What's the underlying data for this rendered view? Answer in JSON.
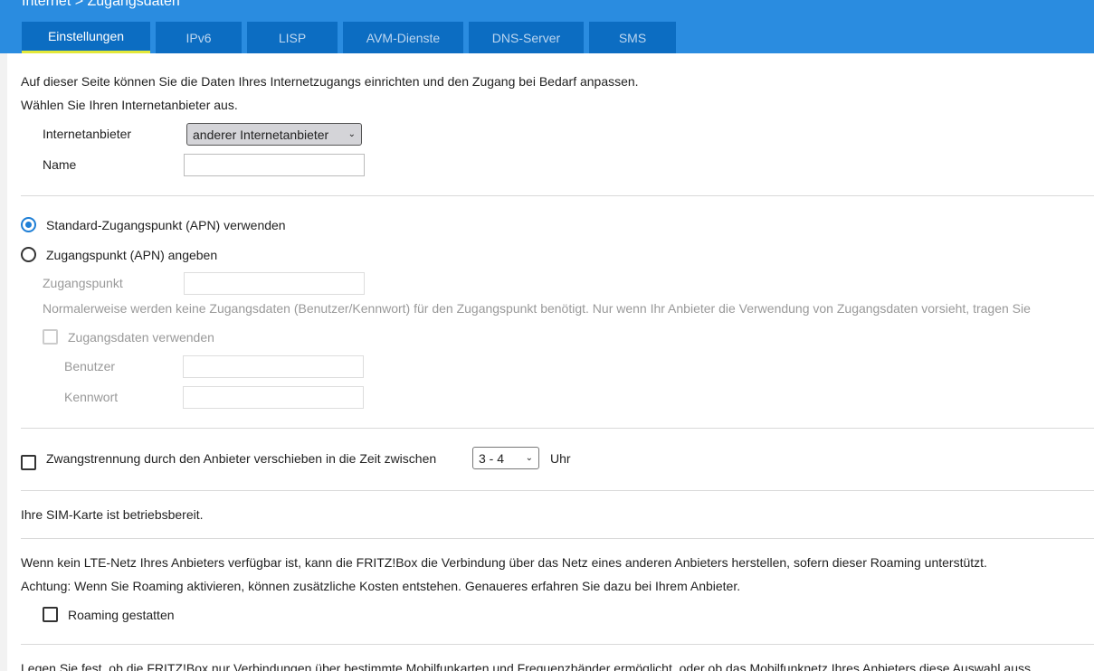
{
  "breadcrumb": "Internet > Zugangsdaten",
  "tabs": [
    "Einstellungen",
    "IPv6",
    "LISP",
    "AVM-Dienste",
    "DNS-Server",
    "SMS"
  ],
  "intro1": "Auf dieser Seite können Sie die Daten Ihres Internetzugangs einrichten und den Zugang bei Bedarf anpassen.",
  "intro2": "Wählen Sie Ihren Internetanbieter aus.",
  "provider_label": "Internetanbieter",
  "provider_value": "anderer Internetanbieter",
  "name_label": "Name",
  "name_value": "",
  "apn_standard": "Standard-Zugangspunkt (APN) verwenden",
  "apn_custom": "Zugangspunkt (APN) angeben",
  "apn_label": "Zugangspunkt",
  "apn_note": "Normalerweise werden keine Zugangsdaten (Benutzer/Kennwort) für den Zugangspunkt benötigt. Nur wenn Ihr Anbieter die Verwendung von Zugangsdaten vorsieht, tragen Sie",
  "use_credentials": "Zugangsdaten verwenden",
  "user_label": "Benutzer",
  "password_label": "Kennwort",
  "forced_disconnect": "Zwangstrennung durch den Anbieter verschieben in die Zeit zwischen",
  "time_value": "3 - 4",
  "time_unit": "Uhr",
  "sim_status": "Ihre SIM-Karte ist betriebsbereit.",
  "roaming_info1": "Wenn kein LTE-Netz Ihres Anbieters verfügbar ist, kann die FRITZ!Box die Verbindung über das Netz eines anderen Anbieters herstellen, sofern dieser Roaming unterstützt.",
  "roaming_info2": "Achtung: Wenn Sie Roaming aktivieren, können zusätzliche Kosten entstehen. Genaueres erfahren Sie dazu bei Ihrem Anbieter.",
  "roaming_label": "Roaming gestatten",
  "band_info": "Legen Sie fest, ob die FRITZ!Box nur Verbindungen über bestimmte Mobilfunkarten und Frequenzbänder ermöglicht, oder ob das Mobilfunknetz Ihres Anbieters diese Auswahl auss"
}
